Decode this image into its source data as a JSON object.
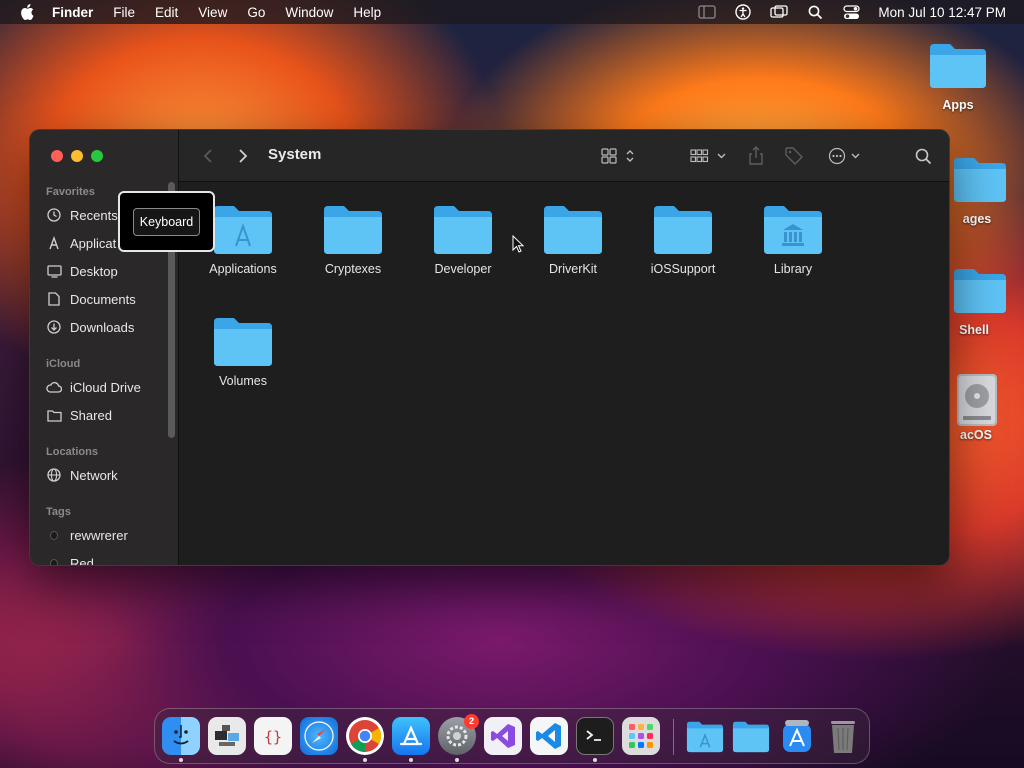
{
  "menubar": {
    "app_name": "Finder",
    "items": [
      "File",
      "Edit",
      "View",
      "Go",
      "Window",
      "Help"
    ],
    "clock": "Mon Jul 10  12:47 PM"
  },
  "desktop": {
    "icons": [
      "Apps",
      "ages",
      "Shell",
      "acOS"
    ]
  },
  "window": {
    "title": "System",
    "sidebar": {
      "favorites_header": "Favorites",
      "favorites": [
        "Recents",
        "Applicat",
        "Desktop",
        "Documents",
        "Downloads"
      ],
      "icloud_header": "iCloud",
      "icloud": [
        "iCloud Drive",
        "Shared"
      ],
      "locations_header": "Locations",
      "locations": [
        "Network"
      ],
      "tags_header": "Tags",
      "tags": [
        "rewwrerer",
        "Red"
      ]
    },
    "folders": [
      "Applications",
      "Cryptexes",
      "Developer",
      "DriverKit",
      "iOSSupport",
      "Library",
      "Volumes"
    ]
  },
  "tooltip": {
    "text": "Keyboard"
  },
  "dock": {
    "settings_badge": "2"
  },
  "colors": {
    "folder_blue": "#5ac8fa",
    "accent_red": "#fe5f57",
    "accent_yellow": "#febc2e",
    "accent_green": "#28c840"
  }
}
